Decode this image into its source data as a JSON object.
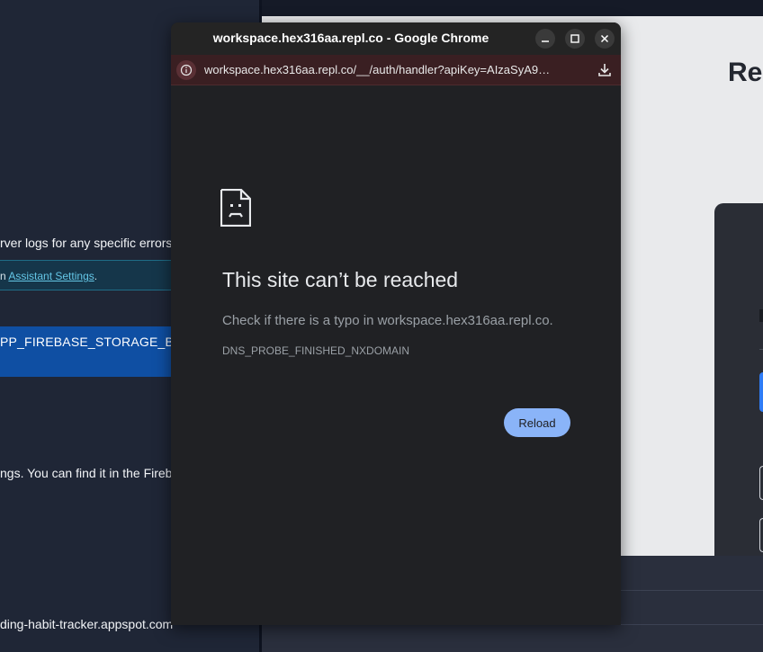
{
  "left_panel": {
    "logs_text": "rver logs for any specific errors",
    "settings_prefix": "n ",
    "settings_link": "Assistant Settings",
    "settings_suffix": ".",
    "env_var_text": "PP_FIREBASE_STORAGE_BUCK",
    "find_text": "ngs. You can find it in the Fireb",
    "bucket_text": "ding-habit-tracker.appspot.com"
  },
  "right_app": {
    "heading": "Re"
  },
  "chrome": {
    "window_title": "workspace.hex316aa.repl.co - Google Chrome",
    "address_url": "workspace.hex316aa.repl.co/__/auth/handler?apiKey=AIzaSyA9…",
    "controls": {
      "minimize": "–",
      "maximize": "□",
      "close": "×"
    },
    "icons": {
      "info": "info-icon",
      "download": "download-icon",
      "sad_page": "sad-page-icon"
    },
    "error": {
      "title": "This site can’t be reached",
      "description": "Check if there is a typo in workspace.hex316aa.repl.co.",
      "code": "DNS_PROBE_FINISHED_NXDOMAIN",
      "reload_label": "Reload"
    },
    "colors": {
      "address_bar": "#3a1f22",
      "reload_button": "#8ab4f8",
      "window_bg": "#202124"
    }
  }
}
